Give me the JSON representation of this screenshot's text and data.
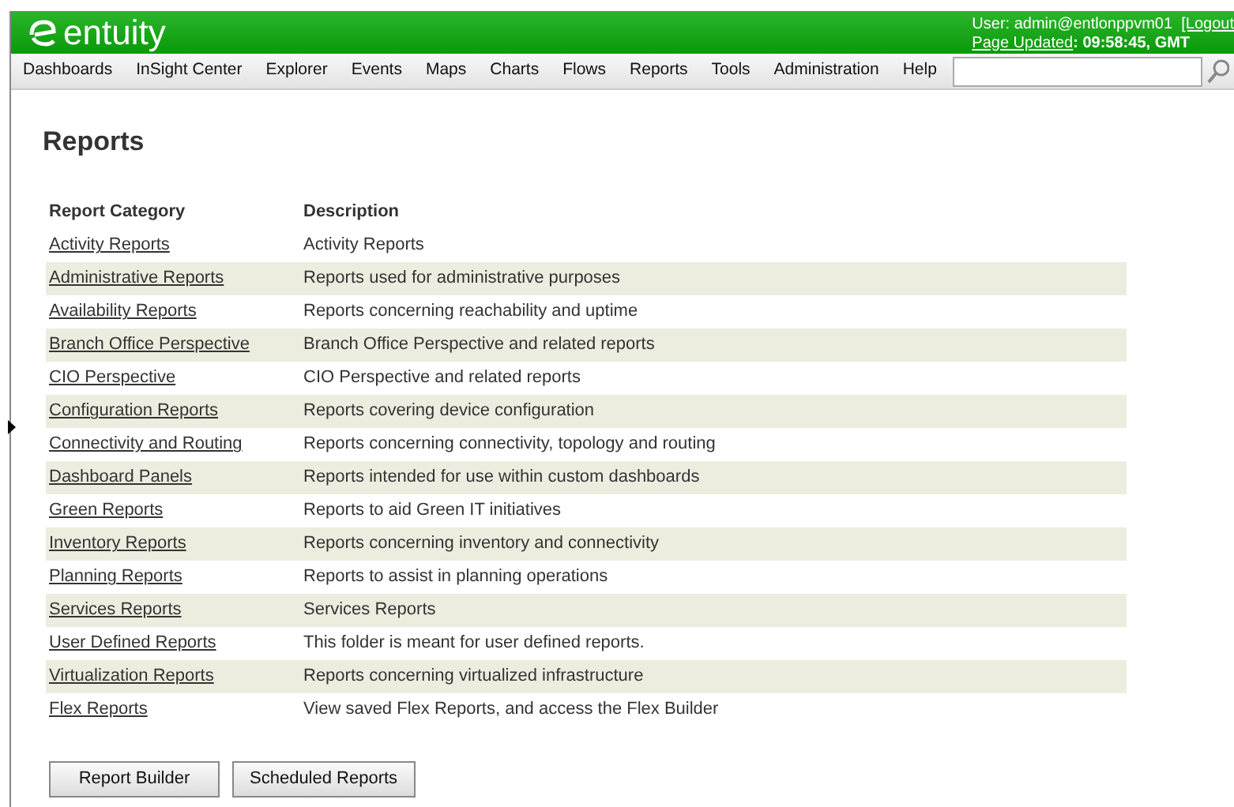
{
  "header": {
    "logo": "entuity",
    "user": "User: admin@entlonppvm01",
    "logout": "[Logout",
    "updated_label": "Page Updated",
    "updated_value": ": 09:58:45, GMT"
  },
  "nav": [
    {
      "label": "Dashboards"
    },
    {
      "label": "InSight Center"
    },
    {
      "label": "Explorer"
    },
    {
      "label": "Events"
    },
    {
      "label": "Maps"
    },
    {
      "label": "Charts"
    },
    {
      "label": "Flows"
    },
    {
      "label": "Reports"
    },
    {
      "label": "Tools"
    },
    {
      "label": "Administration"
    },
    {
      "label": "Help"
    }
  ],
  "page": {
    "title": "Reports"
  },
  "table": {
    "columns": [
      "Report Category",
      "Description"
    ],
    "rows": [
      {
        "category": "Activity Reports",
        "description": "Activity Reports"
      },
      {
        "category": "Administrative Reports",
        "description": "Reports used for administrative purposes"
      },
      {
        "category": "Availability Reports",
        "description": "Reports concerning reachability and uptime"
      },
      {
        "category": "Branch Office Perspective",
        "description": "Branch Office Perspective and related reports"
      },
      {
        "category": "CIO Perspective",
        "description": "CIO Perspective and related reports"
      },
      {
        "category": "Configuration Reports",
        "description": "Reports covering device configuration"
      },
      {
        "category": "Connectivity and Routing",
        "description": "Reports concerning connectivity, topology and routing"
      },
      {
        "category": "Dashboard Panels",
        "description": "Reports intended for use within custom dashboards"
      },
      {
        "category": "Green Reports",
        "description": "Reports to aid Green IT initiatives"
      },
      {
        "category": "Inventory Reports",
        "description": "Reports concerning inventory and connectivity"
      },
      {
        "category": "Planning Reports",
        "description": "Reports to assist in planning operations"
      },
      {
        "category": "Services Reports",
        "description": "Services Reports"
      },
      {
        "category": "User Defined Reports",
        "description": "This folder is meant for user defined reports."
      },
      {
        "category": "Virtualization Reports",
        "description": "Reports concerning virtualized infrastructure"
      },
      {
        "category": "Flex Reports",
        "description": "View saved Flex Reports, and access the Flex Builder"
      }
    ]
  },
  "buttons": [
    "Report Builder",
    "Scheduled Reports"
  ]
}
